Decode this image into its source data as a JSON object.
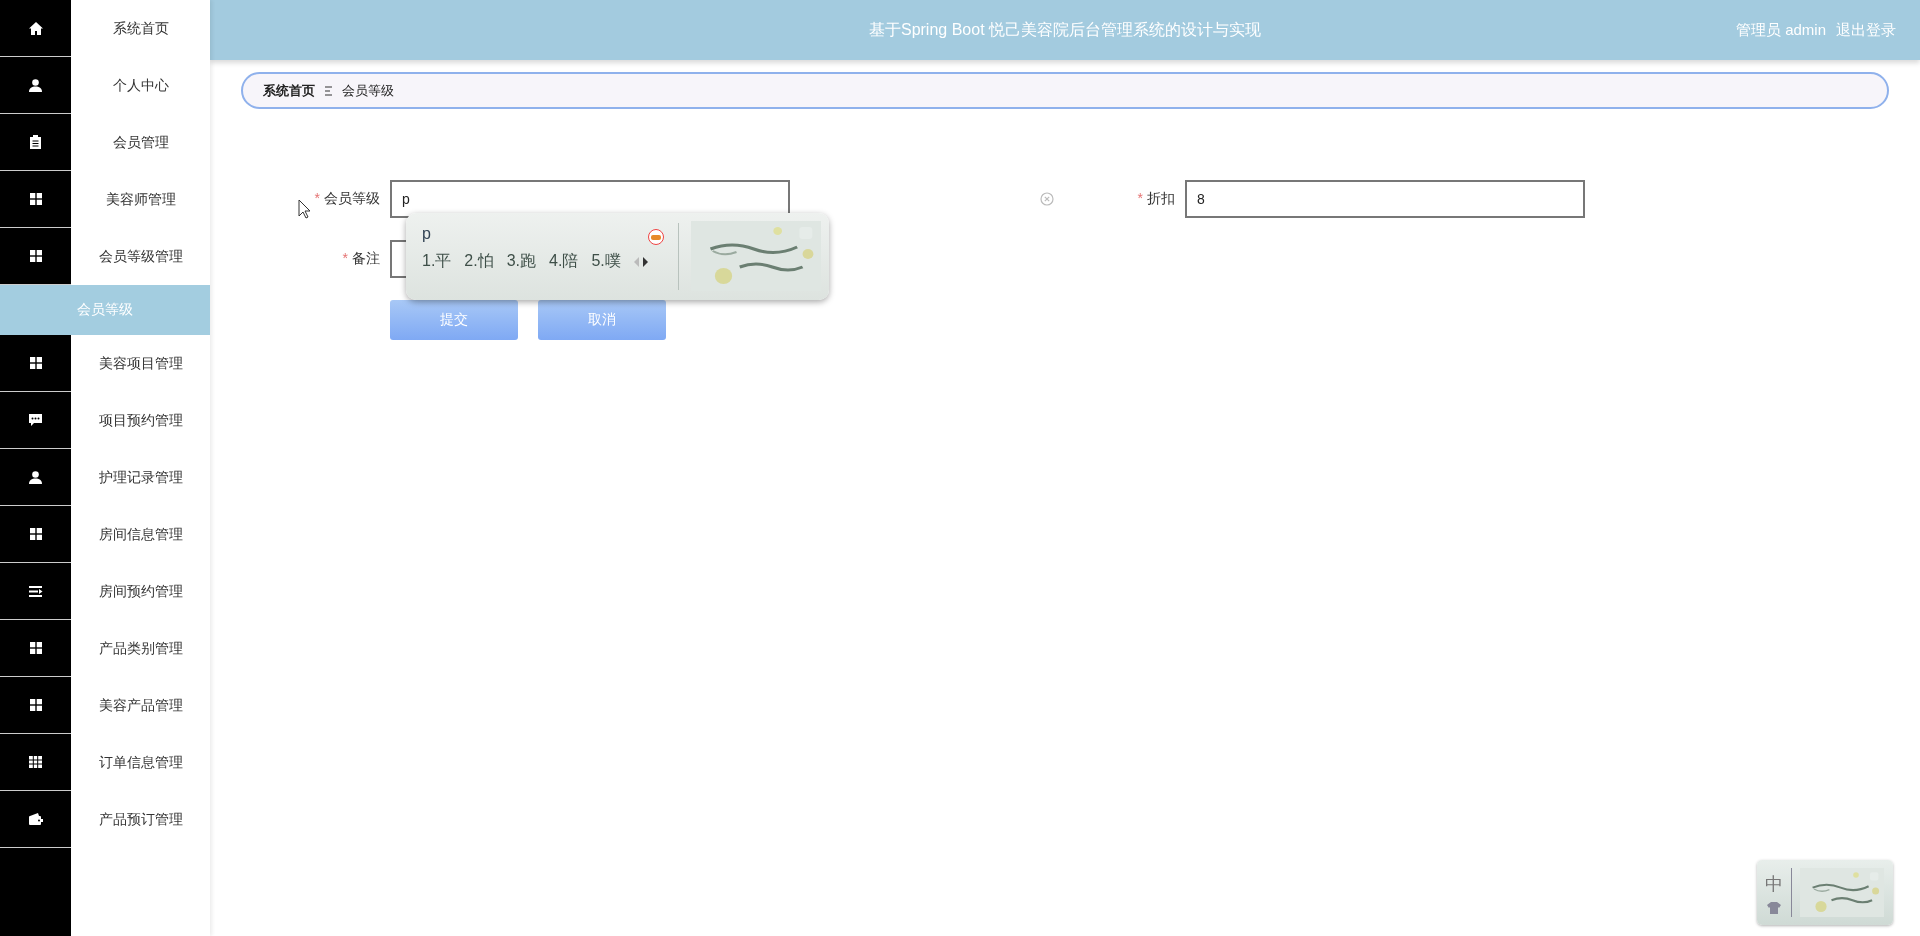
{
  "header": {
    "title": "基于Spring Boot 悦己美容院后台管理系统的设计与实现",
    "user": "管理员 admin",
    "logout": "退出登录"
  },
  "sidebar": {
    "items": [
      {
        "label": "系统首页",
        "selected": false
      },
      {
        "label": "个人中心",
        "selected": false
      },
      {
        "label": "会员管理",
        "selected": false
      },
      {
        "label": "美容师管理",
        "selected": false
      },
      {
        "label": "会员等级管理",
        "selected": false
      },
      {
        "label": "会员等级",
        "selected": true
      },
      {
        "label": "美容项目管理",
        "selected": false
      },
      {
        "label": "项目预约管理",
        "selected": false
      },
      {
        "label": "护理记录管理",
        "selected": false
      },
      {
        "label": "房间信息管理",
        "selected": false
      },
      {
        "label": "房间预约管理",
        "selected": false
      },
      {
        "label": "产品类别管理",
        "selected": false
      },
      {
        "label": "美容产品管理",
        "selected": false
      },
      {
        "label": "订单信息管理",
        "selected": false
      },
      {
        "label": "产品预订管理",
        "selected": false
      }
    ]
  },
  "breadcrumb": {
    "items": [
      "系统首页",
      "会员等级"
    ]
  },
  "form": {
    "fields": [
      {
        "mark": "*",
        "label": "会员等级",
        "value": "p"
      },
      {
        "mark": "*",
        "label": "折扣",
        "value": "8"
      },
      {
        "mark": "*",
        "label": "备注"
      }
    ],
    "buttons": [
      "提交",
      "取消"
    ]
  },
  "ime_popup": {
    "composition": "p",
    "candidates": [
      "1.平",
      "2.怕",
      "3.跑",
      "4.陪",
      "5.噗"
    ]
  },
  "ime_status": {
    "mode": "中"
  }
}
